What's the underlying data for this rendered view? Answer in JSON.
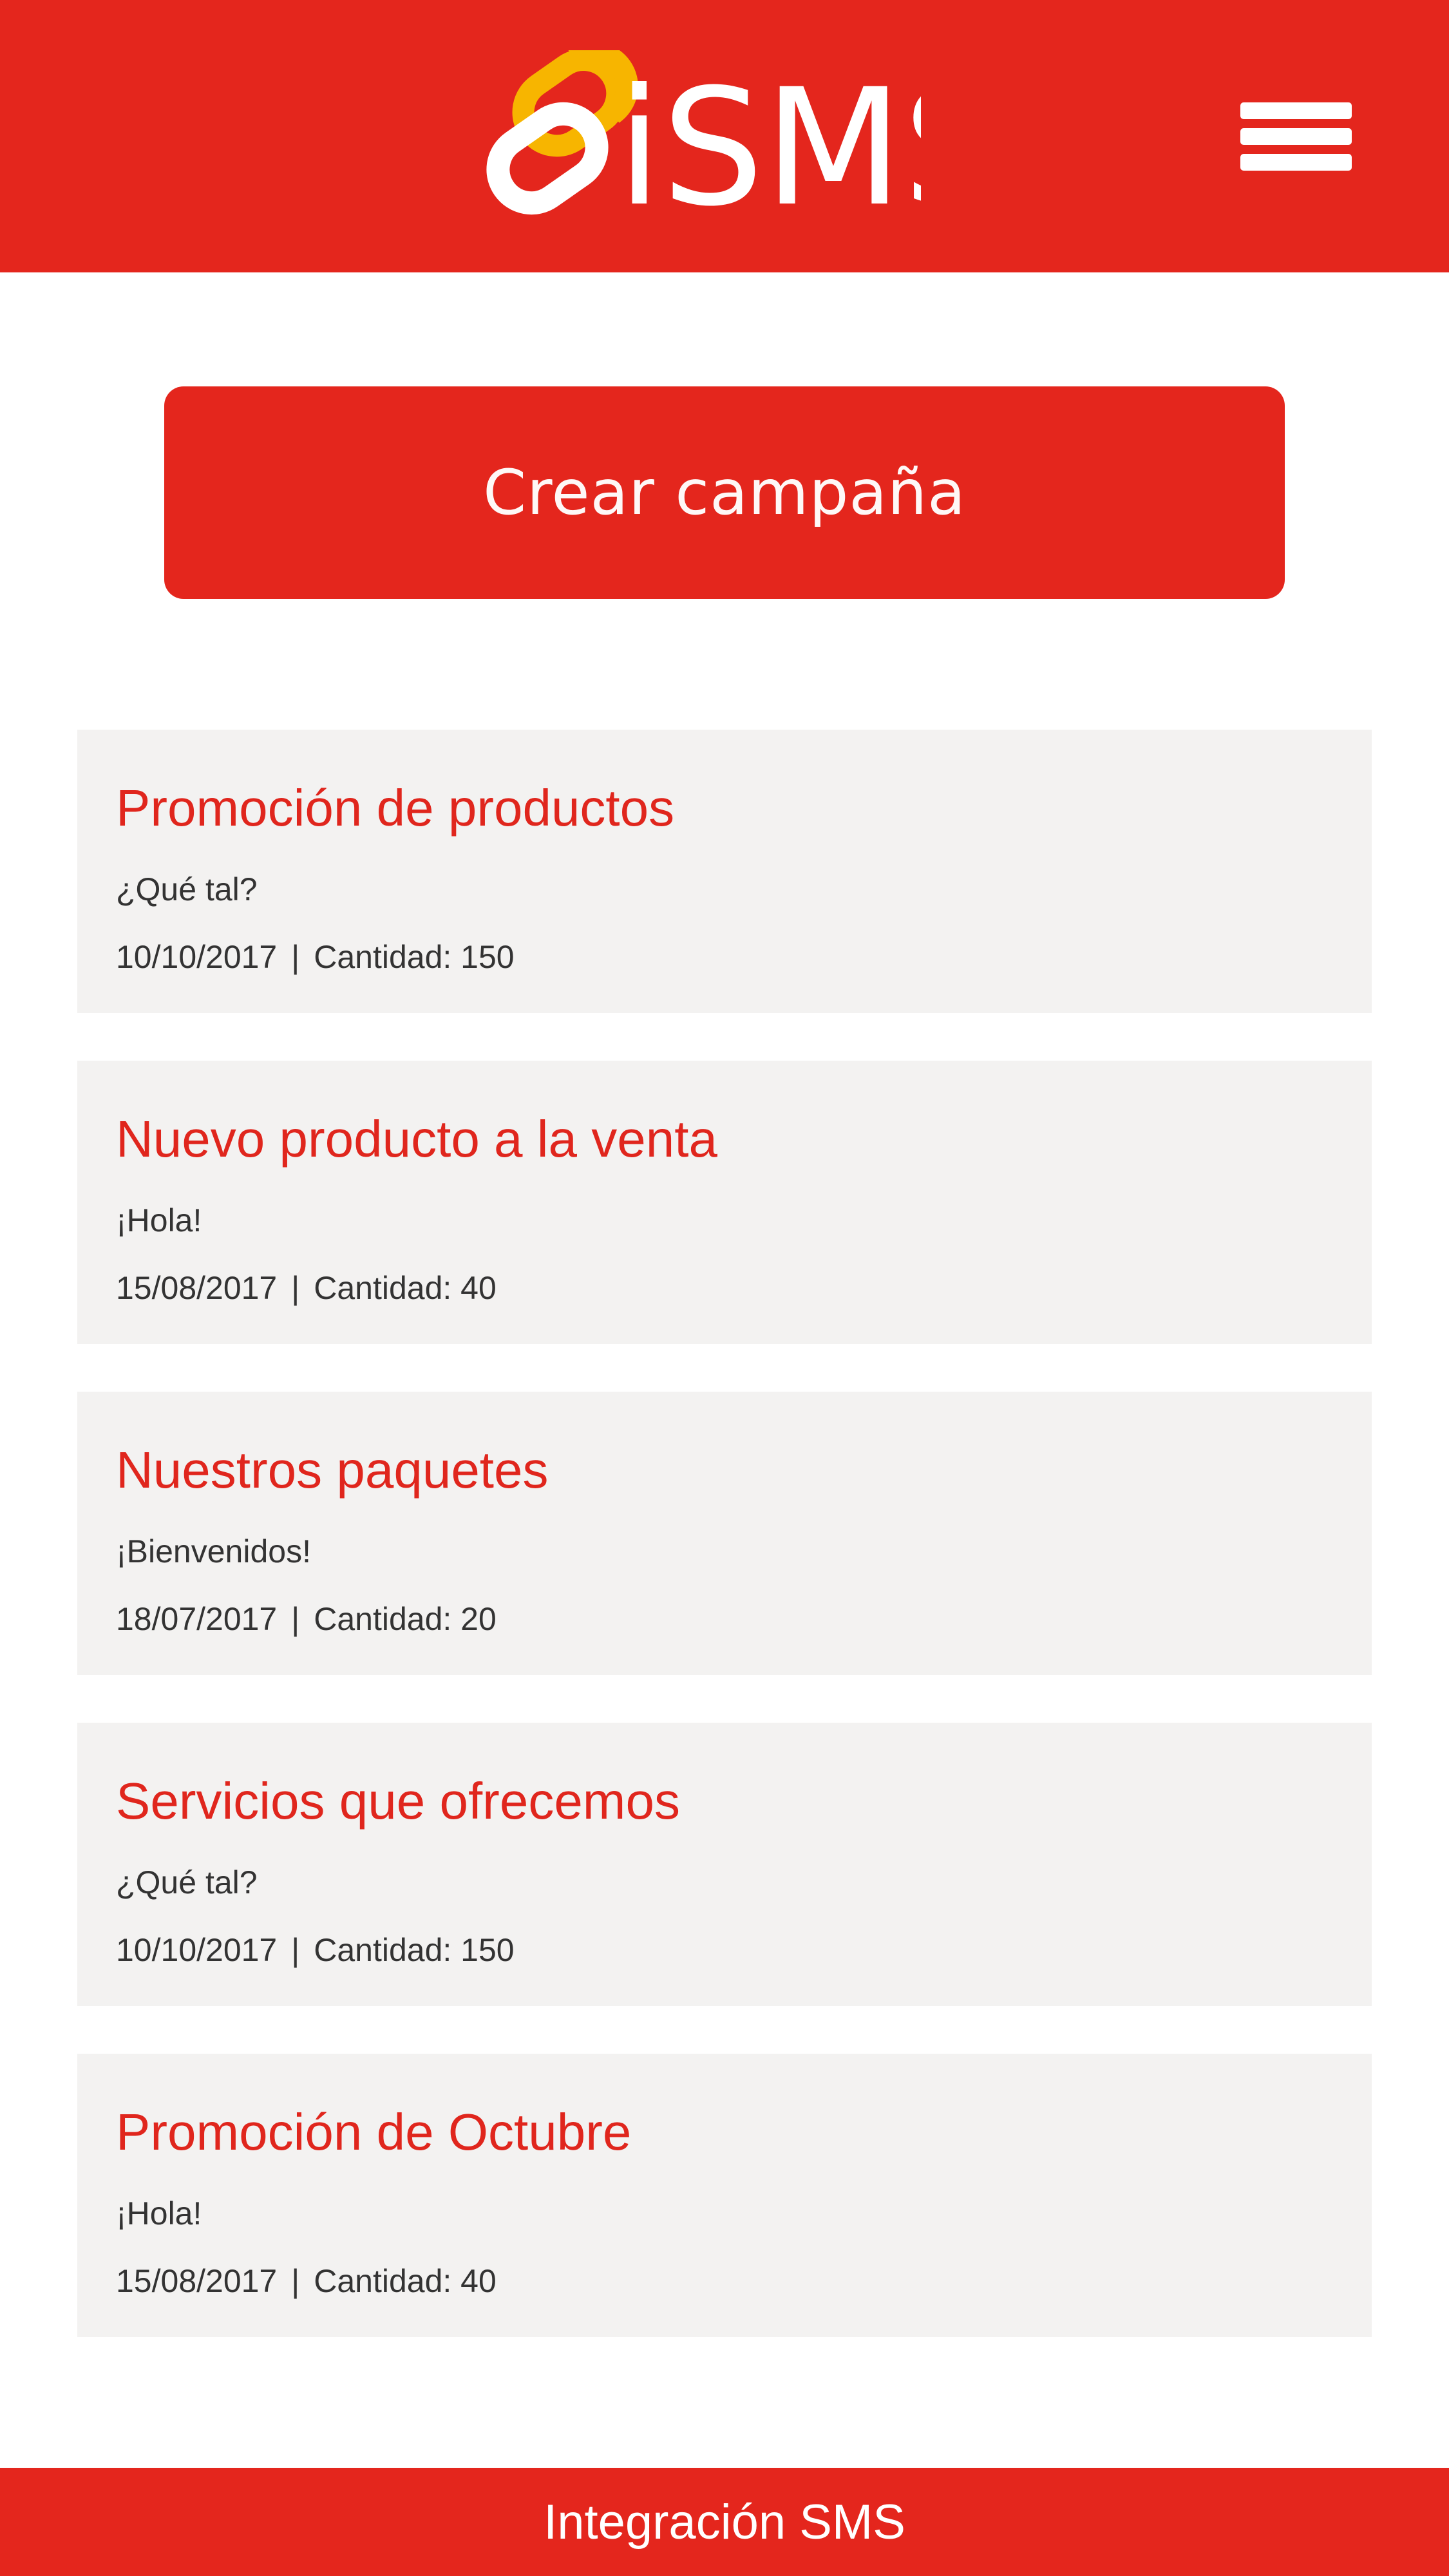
{
  "header": {
    "logo_text": "iSMS",
    "logo_icon": "link-icon",
    "menu_icon": "hamburger-menu-icon",
    "brand_color": "#e4261d",
    "logo_accent_color": "#f7b500"
  },
  "create_campaign": {
    "label": "Crear campaña"
  },
  "campaigns": [
    {
      "title": "Promoción de productos",
      "message": "¿Qué tal?",
      "date": "10/10/2017",
      "separator": "|",
      "quantity": "Cantidad: 150"
    },
    {
      "title": "Nuevo producto a la venta",
      "message": "¡Hola!",
      "date": "15/08/2017",
      "separator": "|",
      "quantity": "Cantidad: 40"
    },
    {
      "title": "Nuestros paquetes",
      "message": "¡Bienvenidos!",
      "date": "18/07/2017",
      "separator": "|",
      "quantity": "Cantidad: 20"
    },
    {
      "title": "Servicios que ofrecemos",
      "message": "¿Qué tal?",
      "date": "10/10/2017",
      "separator": "|",
      "quantity": "Cantidad: 150"
    },
    {
      "title": "Promoción de Octubre",
      "message": "¡Hola!",
      "date": "15/08/2017",
      "separator": "|",
      "quantity": "Cantidad: 40"
    }
  ],
  "footer": {
    "label": "Integración SMS"
  }
}
